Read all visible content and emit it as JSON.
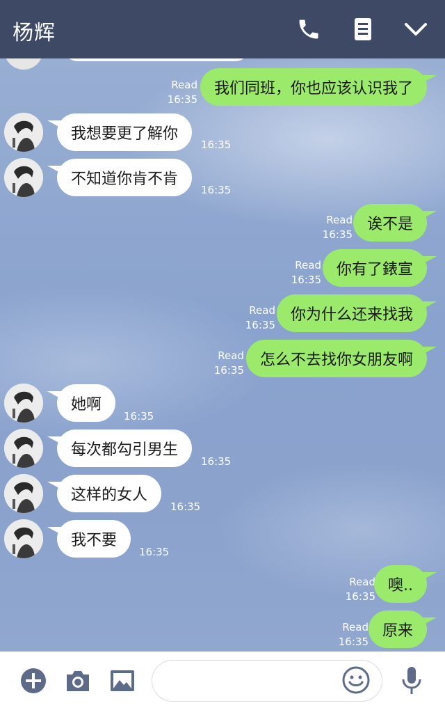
{
  "header": {
    "title": "杨辉"
  },
  "messages": [
    {
      "side": "out",
      "text": "我们同班，你也应该认识我了",
      "read": "Read",
      "time": "16:35"
    },
    {
      "side": "in",
      "text": "我想要更了解你",
      "time": "16:35"
    },
    {
      "side": "in",
      "text": "不知道你肯不肯",
      "time": "16:35"
    },
    {
      "side": "out",
      "text": "诶不是",
      "read": "Read",
      "time": "16:35"
    },
    {
      "side": "out",
      "text": "你有了錶宣",
      "read": "Read",
      "time": "16:35"
    },
    {
      "side": "out",
      "text": "你为什么还来找我",
      "read": "Read",
      "time": "16:35"
    },
    {
      "side": "out",
      "text": "怎么不去找你女朋友啊",
      "read": "Read",
      "time": "16:35"
    },
    {
      "side": "in",
      "text": "她啊",
      "time": "16:35"
    },
    {
      "side": "in",
      "text": "每次都勾引男生",
      "time": "16:35"
    },
    {
      "side": "in",
      "text": "这样的女人",
      "time": "16:35"
    },
    {
      "side": "in",
      "text": "我不要",
      "time": "16:35"
    },
    {
      "side": "out",
      "text": "噢..",
      "read": "Read",
      "time": "16:35"
    },
    {
      "side": "out",
      "text": "原来",
      "read": "Read",
      "time": "16:35"
    }
  ],
  "footer": {
    "input_placeholder": ""
  },
  "icons": {
    "header": [
      "phone-icon",
      "notes-icon",
      "chevron-down-icon"
    ],
    "footer": [
      "plus-icon",
      "camera-icon",
      "image-icon",
      "emoji-icon",
      "microphone-icon"
    ]
  },
  "colors": {
    "header_bg": "#3e4a65",
    "out_bubble": "#9bea6b",
    "in_bubble": "#ffffff"
  }
}
